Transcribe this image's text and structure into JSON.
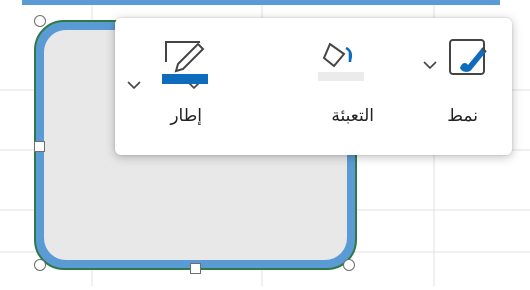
{
  "toolbar": {
    "style": {
      "label": "نمط",
      "icon": "shape-style-icon"
    },
    "fill": {
      "label": "التعبئة",
      "icon": "paint-bucket-icon",
      "color": "#ebebeb"
    },
    "outline": {
      "label": "إطار",
      "icon": "pen-outline-icon",
      "color": "#0f6cbd"
    }
  },
  "shape": {
    "fill_color": "#e8e8e8",
    "outline_color": "#5b9bd5",
    "selection_color": "#2f7a44"
  }
}
